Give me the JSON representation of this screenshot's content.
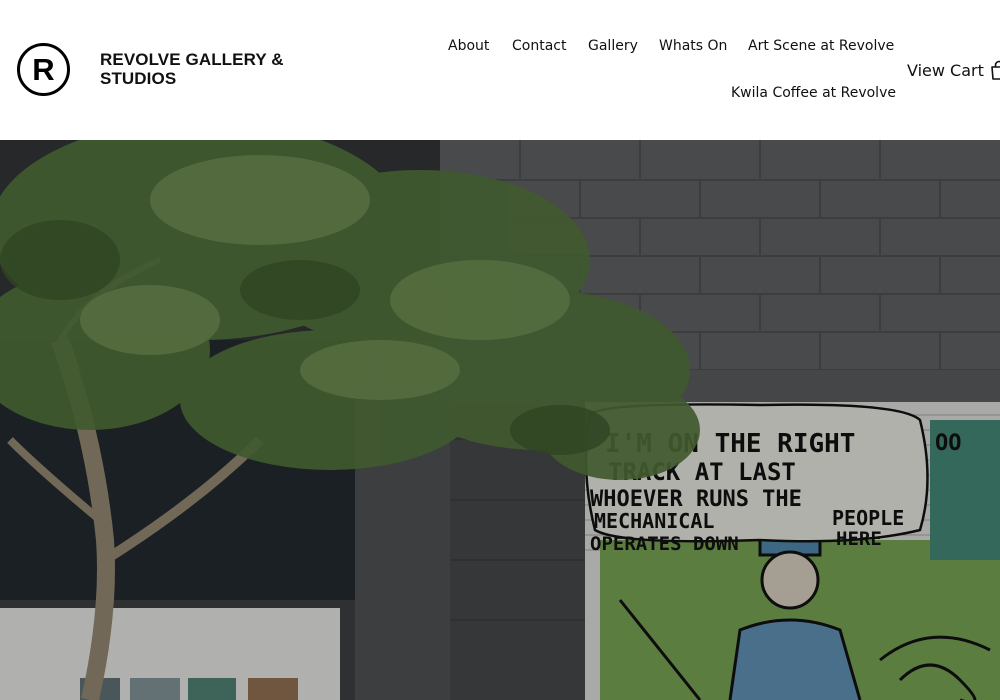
{
  "site": {
    "logo_letter": "R",
    "title": "REVOLVE GALLERY & STUDIOS"
  },
  "nav": {
    "items": [
      {
        "label": "About"
      },
      {
        "label": "Contact"
      },
      {
        "label": "Gallery"
      },
      {
        "label": "Whats On"
      },
      {
        "label": "Art Scene at Revolve"
      },
      {
        "label": "Kwila Coffee at Revolve"
      }
    ]
  },
  "cart": {
    "label": "View Cart",
    "icon": "shopping-bag-icon"
  },
  "hero": {
    "mural_text": [
      "I'M ON THE RIGHT",
      "TRACK AT LAST",
      "WHOEVER RUNS THE",
      "MECHANICAL",
      "OPERATES DOWN",
      "PEOPLE",
      "HERE"
    ],
    "mural_tag": "OO"
  }
}
